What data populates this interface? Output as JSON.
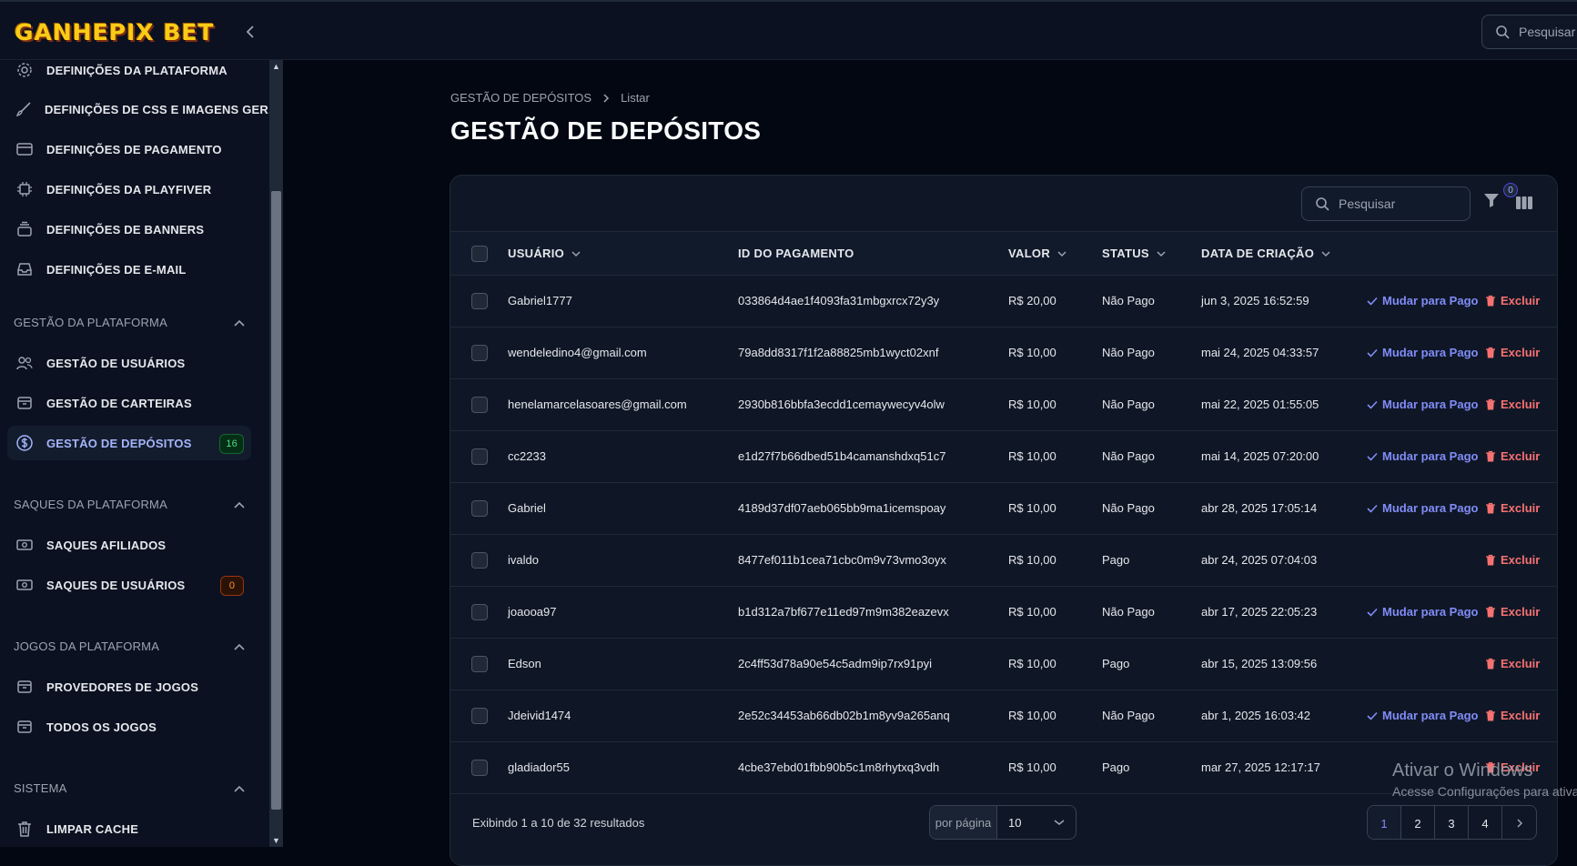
{
  "app": {
    "logo": "GANHEPIX BET",
    "search_placeholder": "Pesquisar"
  },
  "sidebar": {
    "items_top": [
      {
        "label": "DEFINIÇÕES DA PLATAFORMA",
        "icon": "gear-icon"
      },
      {
        "label": "DEFINIÇÕES DE CSS E IMAGENS GER...",
        "icon": "brush-icon"
      },
      {
        "label": "DEFINIÇÕES DE PAGAMENTO",
        "icon": "credit-card-icon"
      },
      {
        "label": "DEFINIÇÕES DA PLAYFIVER",
        "icon": "chip-icon"
      },
      {
        "label": "DEFINIÇÕES DE BANNERS",
        "icon": "stack-icon"
      },
      {
        "label": "DEFINIÇÕES DE E-MAIL",
        "icon": "inbox-icon"
      }
    ],
    "groups": [
      {
        "title": "GESTÃO DA PLATAFORMA",
        "items": [
          {
            "label": "GESTÃO DE USUÁRIOS",
            "icon": "users-icon"
          },
          {
            "label": "GESTÃO DE CARTEIRAS",
            "icon": "archive-icon"
          },
          {
            "label": "GESTÃO DE DEPÓSITOS",
            "icon": "dollar-circle-icon",
            "badge": "16",
            "active": true
          }
        ]
      },
      {
        "title": "SAQUES DA PLATAFORMA",
        "items": [
          {
            "label": "SAQUES AFILIADOS",
            "icon": "cash-icon"
          },
          {
            "label": "SAQUES DE USUÁRIOS",
            "icon": "cash-icon",
            "badge": "0"
          }
        ]
      },
      {
        "title": "JOGOS DA PLATAFORMA",
        "items": [
          {
            "label": "PROVEDORES DE JOGOS",
            "icon": "archive-icon"
          },
          {
            "label": "TODOS OS JOGOS",
            "icon": "archive-icon"
          }
        ]
      },
      {
        "title": "SISTEMA",
        "items": [
          {
            "label": "LIMPAR CACHE",
            "icon": "trash-icon"
          }
        ]
      }
    ]
  },
  "page": {
    "breadcrumb": [
      "GESTÃO DE DEPÓSITOS",
      "Listar"
    ],
    "title": "GESTÃO DE DEPÓSITOS"
  },
  "table": {
    "search_placeholder": "Pesquisar",
    "filter_count": "0",
    "columns": [
      "USUÁRIO",
      "ID DO PAGAMENTO",
      "VALOR",
      "STATUS",
      "DATA DE CRIAÇÃO"
    ],
    "action_pay": "Mudar para Pago",
    "action_delete": "Excluir",
    "rows": [
      {
        "user": "Gabriel1777",
        "id": "033864d4ae1f4093fa31mbgxrcx72y3y",
        "value": "R$ 20,00",
        "status": "Não Pago",
        "date": "jun 3, 2025 16:52:59"
      },
      {
        "user": "wendeledino4@gmail.com",
        "id": "79a8dd8317f1f2a88825mb1wyct02xnf",
        "value": "R$ 10,00",
        "status": "Não Pago",
        "date": "mai 24, 2025 04:33:57"
      },
      {
        "user": "henelamarcelasoares@gmail.com",
        "id": "2930b816bbfa3ecdd1cemaywecyv4olw",
        "value": "R$ 10,00",
        "status": "Não Pago",
        "date": "mai 22, 2025 01:55:05"
      },
      {
        "user": "cc2233",
        "id": "e1d27f7b66dbed51b4camanshdxq51c7",
        "value": "R$ 10,00",
        "status": "Não Pago",
        "date": "mai 14, 2025 07:20:00"
      },
      {
        "user": "Gabriel",
        "id": "4189d37df07aeb065bb9ma1icemspoay",
        "value": "R$ 10,00",
        "status": "Não Pago",
        "date": "abr 28, 2025 17:05:14"
      },
      {
        "user": "ivaldo",
        "id": "8477ef011b1cea71cbc0m9v73vmo3oyx",
        "value": "R$ 10,00",
        "status": "Pago",
        "date": "abr 24, 2025 07:04:03"
      },
      {
        "user": "joaooa97",
        "id": "b1d312a7bf677e11ed97m9m382eazevx",
        "value": "R$ 10,00",
        "status": "Não Pago",
        "date": "abr 17, 2025 22:05:23"
      },
      {
        "user": "Edson",
        "id": "2c4ff53d78a90e54c5adm9ip7rx91pyi",
        "value": "R$ 10,00",
        "status": "Pago",
        "date": "abr 15, 2025 13:09:56"
      },
      {
        "user": "Jdeivid1474",
        "id": "2e52c34453ab66db02b1m8yv9a265anq",
        "value": "R$ 10,00",
        "status": "Não Pago",
        "date": "abr 1, 2025 16:03:42"
      },
      {
        "user": "gladiador55",
        "id": "4cbe37ebd01fbb90b5c1m8rhytxq3vdh",
        "value": "R$ 10,00",
        "status": "Pago",
        "date": "mar 27, 2025 12:17:17"
      }
    ],
    "footer": {
      "results_text": "Exibindo 1 a 10 de 32 resultados",
      "per_page_label": "por página",
      "per_page_value": "10",
      "pages": [
        "1",
        "2",
        "3",
        "4"
      ]
    }
  },
  "watermark": {
    "line1": "Ativar o Windows",
    "line2": "Acesse Configurações para ativar o Windows."
  }
}
